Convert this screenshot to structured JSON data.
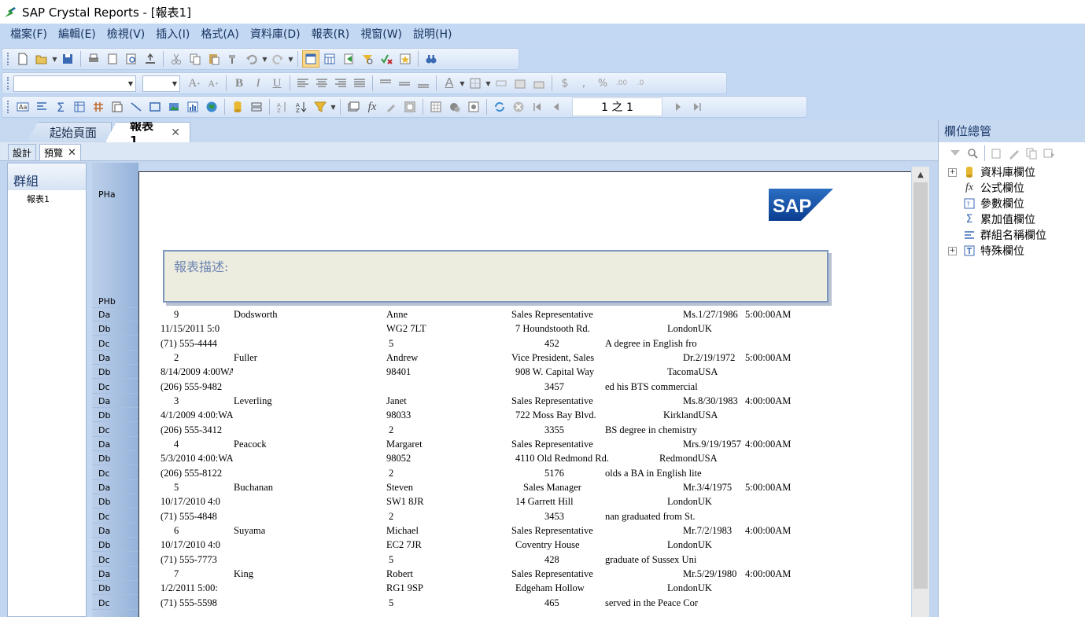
{
  "window": {
    "title": "SAP Crystal Reports - [報表1]"
  },
  "menu": [
    "檔案(F)",
    "編輯(E)",
    "檢視(V)",
    "插入(I)",
    "格式(A)",
    "資料庫(D)",
    "報表(R)",
    "視窗(W)",
    "說明(H)"
  ],
  "toolbar": {
    "page_indicator": "1 之 1"
  },
  "tabs": {
    "start": "起始頁面",
    "report": "報表1",
    "close": "✕"
  },
  "view_tabs": {
    "design": "設計",
    "preview": "預覽",
    "close": "✕"
  },
  "group_tree": {
    "header": "群組",
    "node": "報表1"
  },
  "sections": [
    "PHa",
    "PHb",
    "Da",
    "Db",
    "Dc",
    "Da",
    "Db",
    "Dc",
    "Da",
    "Db",
    "Dc",
    "Da",
    "Db",
    "Dc",
    "Da",
    "Db",
    "Dc",
    "Da",
    "Db",
    "Dc",
    "Da",
    "Db",
    "Dc"
  ],
  "report": {
    "logo_text": "SAP",
    "description_label": "報表描述:",
    "rows": [
      [
        "9",
        "Dodsworth",
        "Anne",
        "Sales Representative",
        "Ms.1/27/1986",
        "5:00:00AM"
      ],
      [
        "11/15/2011   5:0",
        "",
        "WG2 7LT",
        "7 Houndstooth Rd.",
        "LondonUK",
        ""
      ],
      [
        "(71) 555-4444",
        "",
        "5",
        "452",
        "A degree in English fro",
        ""
      ],
      [
        "2",
        "Fuller",
        "Andrew",
        "Vice President, Sales",
        "Dr.2/19/1972",
        "5:00:00AM"
      ],
      [
        "8/14/2009  4:00WA",
        "",
        "98401",
        "908 W. Capital Way",
        "TacomaUSA",
        ""
      ],
      [
        "(206) 555-9482",
        "",
        "",
        "3457",
        "ed his BTS commercial",
        ""
      ],
      [
        "3",
        "Leverling",
        "Janet",
        "Sales Representative",
        "Ms.8/30/1983",
        "4:00:00AM"
      ],
      [
        "4/1/2009  4:00:WA",
        "",
        "98033",
        "722 Moss Bay Blvd.",
        "KirklandUSA",
        ""
      ],
      [
        "(206) 555-3412",
        "",
        "2",
        "3355",
        "BS degree in chemistry",
        ""
      ],
      [
        "4",
        "Peacock",
        "Margaret",
        "Sales Representative",
        "Mrs.9/19/1957",
        "4:00:00AM"
      ],
      [
        "5/3/2010  4:00:WA",
        "",
        "98052",
        "4110 Old Redmond Rd.",
        "RedmondUSA",
        ""
      ],
      [
        "(206) 555-8122",
        "",
        "2",
        "5176",
        "olds a BA in English lite",
        ""
      ],
      [
        "5",
        "Buchanan",
        "Steven",
        "Sales Manager",
        "Mr.3/4/1975",
        "5:00:00AM"
      ],
      [
        "10/17/2010   4:0",
        "",
        "SW1 8JR",
        "14 Garrett Hill",
        "LondonUK",
        ""
      ],
      [
        "(71) 555-4848",
        "",
        "2",
        "3453",
        "nan graduated from St.",
        ""
      ],
      [
        "6",
        "Suyama",
        "Michael",
        "Sales Representative",
        "Mr.7/2/1983",
        "4:00:00AM"
      ],
      [
        "10/17/2010   4:0",
        "",
        "EC2 7JR",
        "Coventry House",
        "LondonUK",
        ""
      ],
      [
        "(71) 555-7773",
        "",
        "5",
        "428",
        "graduate of Sussex Uni",
        ""
      ],
      [
        "7",
        "King",
        "Robert",
        "Sales Representative",
        "Mr.5/29/1980",
        "4:00:00AM"
      ],
      [
        "1/2/2011  5:00:",
        "",
        "RG1 9SP",
        "Edgeham Hollow",
        "LondonUK",
        ""
      ],
      [
        "(71) 555-5598",
        "",
        "5",
        "465",
        "served in the Peace Cor",
        ""
      ]
    ]
  },
  "field_explorer": {
    "title": "欄位總管",
    "items": [
      "資料庫欄位",
      "公式欄位",
      "參數欄位",
      "累加值欄位",
      "群組名稱欄位",
      "特殊欄位"
    ]
  }
}
